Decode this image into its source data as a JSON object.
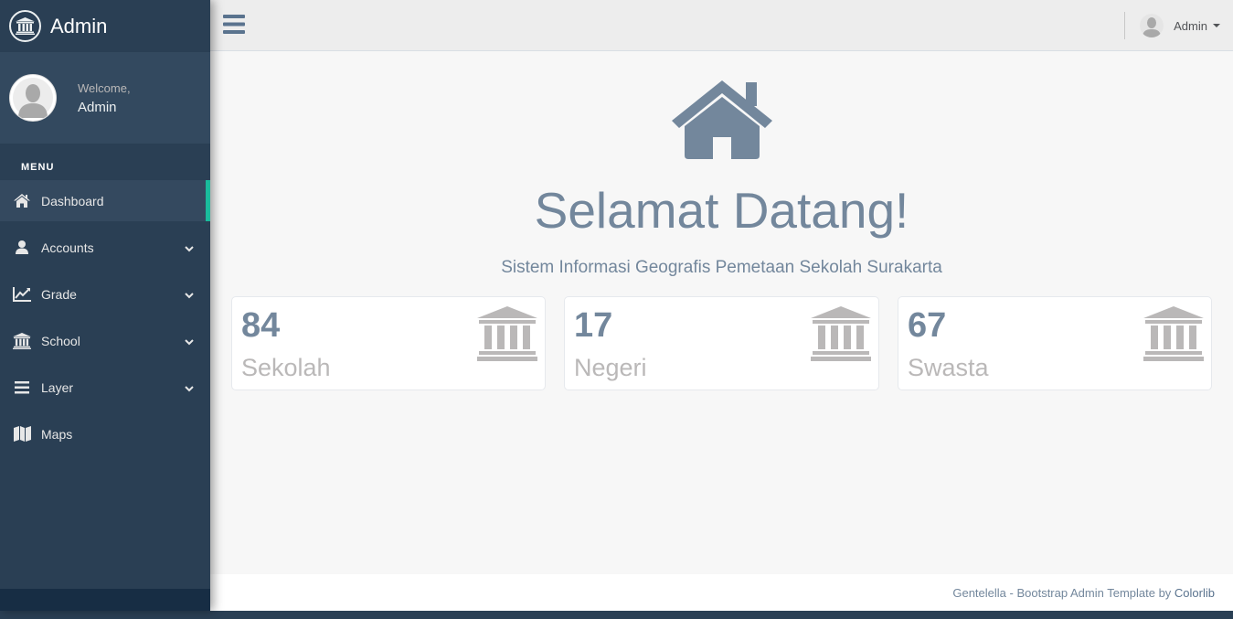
{
  "sidebar": {
    "brand_title": "Admin",
    "profile": {
      "welcome": "Welcome,",
      "name": "Admin"
    },
    "menu_title": "MENU",
    "items": [
      {
        "label": "Dashboard",
        "icon": "home-icon",
        "active": true
      },
      {
        "label": "Accounts",
        "icon": "user-icon",
        "has_submenu": true
      },
      {
        "label": "Grade",
        "icon": "line-chart-icon",
        "has_submenu": true
      },
      {
        "label": "School",
        "icon": "institution-icon",
        "has_submenu": true
      },
      {
        "label": "Layer",
        "icon": "bars-icon",
        "has_submenu": true
      },
      {
        "label": "Maps",
        "icon": "map-icon"
      }
    ]
  },
  "topnav": {
    "user_name": "Admin"
  },
  "hero": {
    "title": "Selamat Datang!",
    "subtitle": "Sistem Informasi Geografis Pemetaan Sekolah Surakarta"
  },
  "tiles": [
    {
      "count": "84",
      "label": "Sekolah",
      "icon": "institution-icon"
    },
    {
      "count": "17",
      "label": "Negeri",
      "icon": "institution-icon"
    },
    {
      "count": "67",
      "label": "Swasta",
      "icon": "institution-icon"
    }
  ],
  "footer": {
    "text": "Gentelella - Bootstrap Admin Template by ",
    "link": "Colorlib"
  },
  "colors": {
    "sidebar_bg": "#2A3F54",
    "accent": "#1ABB9C",
    "text_muted": "#73879C",
    "tile_icon": "#BAB8B8"
  }
}
